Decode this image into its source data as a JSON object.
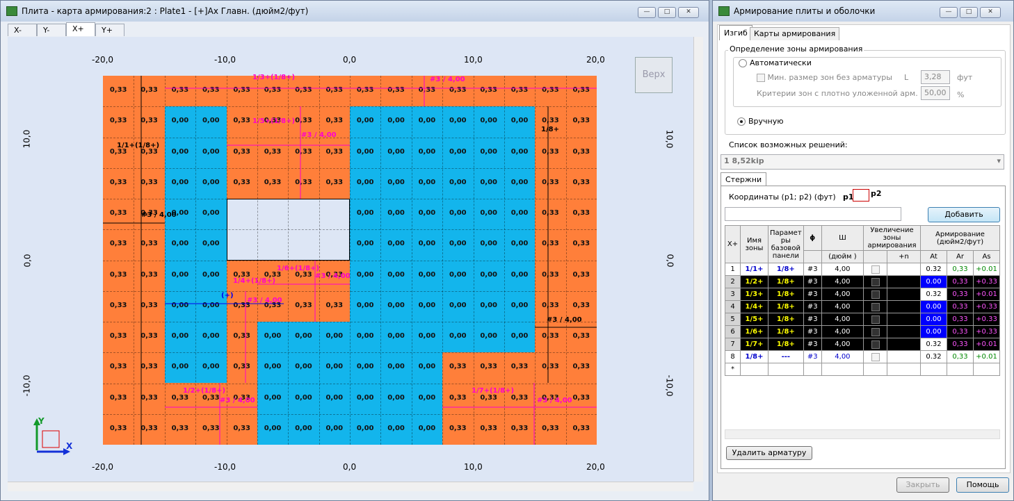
{
  "main_window": {
    "title": "Плита - карта армирования:2 : Plate1 - [+]Ах Главн. (дюйм2/фут)",
    "tabs": [
      "X-",
      "Y-",
      "X+",
      "Y+"
    ],
    "active_tab": "X+",
    "top_button": "Верх",
    "x_axis_labels": [
      "-20,0",
      "-10,0",
      "0,0",
      "10,0",
      "20,0"
    ],
    "y_axis_labels": [
      "10,0",
      "0,0",
      "-10,0"
    ],
    "y_axis_labels_right": [
      "10,0",
      "0,0",
      "-10,0"
    ],
    "rebar_labels": [
      "1/3+(1/8+)",
      "#3 / 4,00",
      "1/5+(1/8+)",
      "#3 / 4,00",
      "1/1+(1/8+)",
      "#3 / 4,00",
      "1/8+",
      "1/6+(1/8+)",
      "1/4+(1/8+)",
      "#3 / 4,00",
      "(+)",
      "#3 / 4,00",
      "#3 / 4,00",
      "1/2+(1/8+)",
      "#3 / 4,00",
      "1/7+(1/8+)",
      "#3 / 4,00"
    ],
    "axis_x": "X",
    "axis_y": "Y"
  },
  "side_window": {
    "title": "Армирование плиты и оболочки",
    "tabs": [
      "Изгиб",
      "Карты армирования"
    ],
    "group_title": "Определение зоны армирования",
    "auto_label": "Автоматически",
    "min_size_label": "Мин. размер зон без арматуры",
    "L_label": "L",
    "L_value": "3,28",
    "L_unit": "фут",
    "criteria_label": "Критерии зон с плотно уложенной арм.",
    "criteria_value": "50,00",
    "criteria_unit": "%",
    "manual_label": "Вручную",
    "solutions_label": "Список возможных решений:",
    "solution_value": "1   8,52kip",
    "rods_tab": "Стержни",
    "coords_label": "Координаты (p1; p2) (фут)",
    "p1": "p1",
    "p2": "p2",
    "add_button": "Добавить",
    "headers": {
      "xp": "X+",
      "name": "Имя зоны",
      "params": "Парамет ры базовой панели",
      "phi": "ϕ",
      "sh": "Ш",
      "sh_unit": "(дюйм )",
      "inc": "Увеличение зоны армирования",
      "n": "+n",
      "arm": "Армирование (дюйм2/фут)",
      "at": "At",
      "ar": "Ar",
      "as": "As"
    },
    "rows": [
      {
        "n": "1",
        "name": "1/1+",
        "param": "1/8+",
        "phi": "#3",
        "w": "4,00",
        "at": "0.32",
        "ar": "0,33",
        "as": "+0.01",
        "style": "light"
      },
      {
        "n": "2",
        "name": "1/2+",
        "param": "1/8+",
        "phi": "#3",
        "w": "4,00",
        "at": "0.00",
        "ar": "0,33",
        "as": "+0.33",
        "style": "darkblue"
      },
      {
        "n": "3",
        "name": "1/3+",
        "param": "1/8+",
        "phi": "#3",
        "w": "4,00",
        "at": "0.32",
        "ar": "0,33",
        "as": "+0.01",
        "style": "dark"
      },
      {
        "n": "4",
        "name": "1/4+",
        "param": "1/8+",
        "phi": "#3",
        "w": "4,00",
        "at": "0.00",
        "ar": "0,33",
        "as": "+0.33",
        "style": "darkblue"
      },
      {
        "n": "5",
        "name": "1/5+",
        "param": "1/8+",
        "phi": "#3",
        "w": "4,00",
        "at": "0.00",
        "ar": "0,33",
        "as": "+0.33",
        "style": "darkblue"
      },
      {
        "n": "6",
        "name": "1/6+",
        "param": "1/8+",
        "phi": "#3",
        "w": "4,00",
        "at": "0.00",
        "ar": "0,33",
        "as": "+0.33",
        "style": "darkblue"
      },
      {
        "n": "7",
        "name": "1/7+",
        "param": "1/8+",
        "phi": "#3",
        "w": "4,00",
        "at": "0.32",
        "ar": "0,33",
        "as": "+0.01",
        "style": "dark"
      },
      {
        "n": "8",
        "name": "1/8+",
        "param": "---",
        "phi": "#3",
        "w": "4,00",
        "at": "0.32",
        "ar": "0,33",
        "as": "+0.01",
        "style": "light"
      }
    ],
    "new_row": "*",
    "delete_button": "Удалить арматуру",
    "close_button": "Закрыть",
    "help_button": "Помощь"
  }
}
